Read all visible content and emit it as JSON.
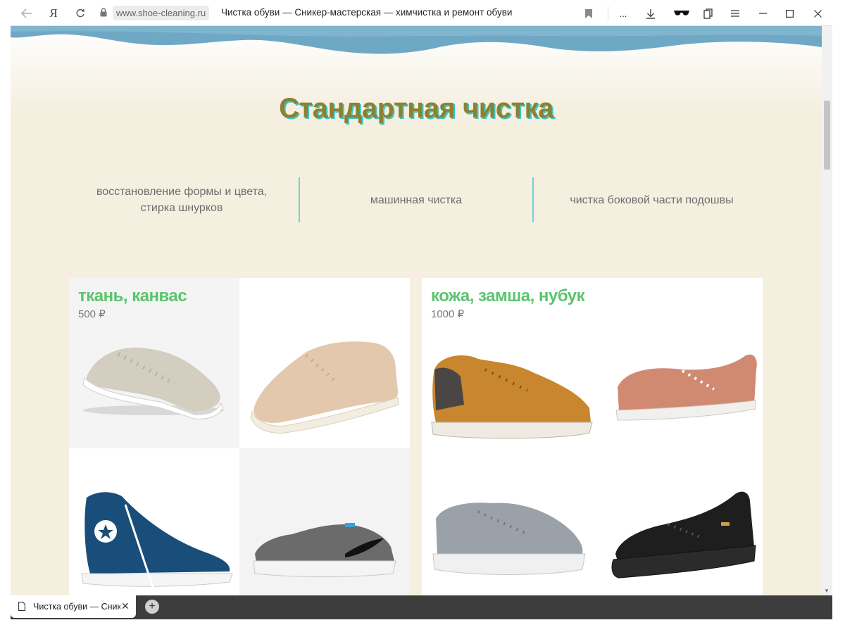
{
  "browser": {
    "domain": "www.shoe-cleaning.ru",
    "page_title": "Чистка обуви — Сникер-мастерская — химчистка и ремонт обуви",
    "menu_more": "...",
    "yandex_logo": "Я"
  },
  "section": {
    "heading": "Стандартная чистка",
    "features": [
      "восстановление формы и цвета,\nстирка шнурков",
      "машинная чистка",
      "чистка боковой части подошвы"
    ]
  },
  "cards": [
    {
      "title": "ткань, канвас",
      "price": "500 ₽",
      "images": [
        "beige-canvas-sneaker",
        "tan-knit-sneaker",
        "blue-high-top-sneaker",
        "grey-skate-sneaker"
      ]
    },
    {
      "title": "кожа, замша, нубук",
      "price": "1000 ₽",
      "images": [
        "tan-nubuck-boot-sneaker",
        "pink-suede-sneaker",
        "grey-suede-runner",
        "black-leather-sneaker"
      ]
    }
  ],
  "tabs": [
    {
      "label": "Чистка обуви — Сникер-мастерская"
    }
  ],
  "colors": {
    "heading": "#8a8232",
    "heading_shadow": "#43c6c6",
    "card_title": "#5cc46e",
    "divider": "#6ad5d9",
    "page_bg": "#f5efe0"
  }
}
